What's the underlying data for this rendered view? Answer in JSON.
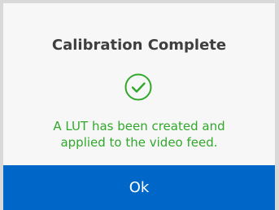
{
  "dialog": {
    "title": "Calibration Complete",
    "status_icon": "check-circle-icon",
    "message_line1": "A LUT has been created and",
    "message_line2": "applied to the video feed.",
    "ok_label": "Ok"
  },
  "colors": {
    "backdrop": "#d9d9d9",
    "dialog_background": "#f7f7f7",
    "title": "#3f3f3f",
    "success": "#31a82c",
    "button": "#0067c8",
    "button_text": "#ffffff"
  }
}
